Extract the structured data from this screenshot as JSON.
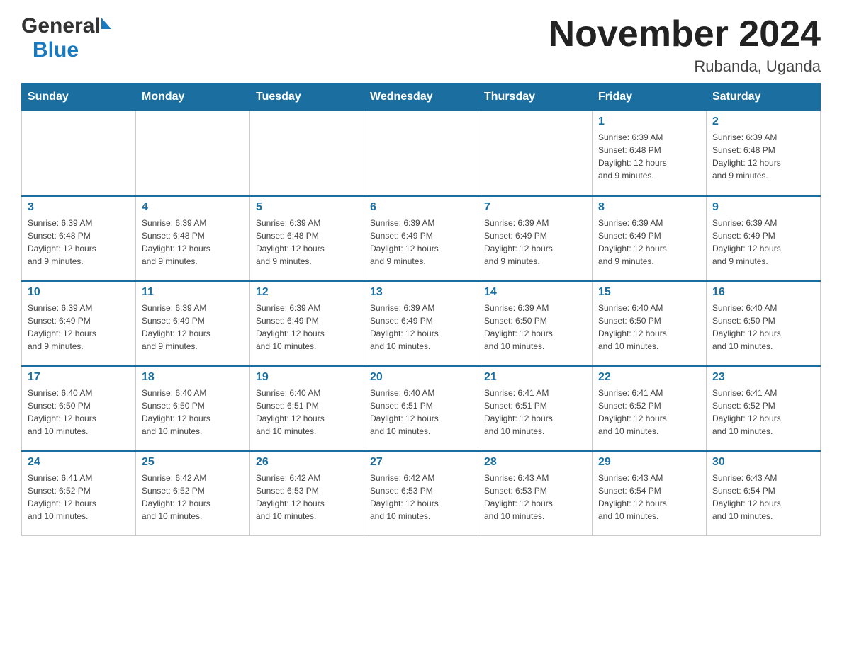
{
  "header": {
    "logo_general": "General",
    "logo_blue": "Blue",
    "month_title": "November 2024",
    "location": "Rubanda, Uganda"
  },
  "days_of_week": [
    "Sunday",
    "Monday",
    "Tuesday",
    "Wednesday",
    "Thursday",
    "Friday",
    "Saturday"
  ],
  "weeks": [
    [
      {
        "day": "",
        "info": ""
      },
      {
        "day": "",
        "info": ""
      },
      {
        "day": "",
        "info": ""
      },
      {
        "day": "",
        "info": ""
      },
      {
        "day": "",
        "info": ""
      },
      {
        "day": "1",
        "info": "Sunrise: 6:39 AM\nSunset: 6:48 PM\nDaylight: 12 hours\nand 9 minutes."
      },
      {
        "day": "2",
        "info": "Sunrise: 6:39 AM\nSunset: 6:48 PM\nDaylight: 12 hours\nand 9 minutes."
      }
    ],
    [
      {
        "day": "3",
        "info": "Sunrise: 6:39 AM\nSunset: 6:48 PM\nDaylight: 12 hours\nand 9 minutes."
      },
      {
        "day": "4",
        "info": "Sunrise: 6:39 AM\nSunset: 6:48 PM\nDaylight: 12 hours\nand 9 minutes."
      },
      {
        "day": "5",
        "info": "Sunrise: 6:39 AM\nSunset: 6:48 PM\nDaylight: 12 hours\nand 9 minutes."
      },
      {
        "day": "6",
        "info": "Sunrise: 6:39 AM\nSunset: 6:49 PM\nDaylight: 12 hours\nand 9 minutes."
      },
      {
        "day": "7",
        "info": "Sunrise: 6:39 AM\nSunset: 6:49 PM\nDaylight: 12 hours\nand 9 minutes."
      },
      {
        "day": "8",
        "info": "Sunrise: 6:39 AM\nSunset: 6:49 PM\nDaylight: 12 hours\nand 9 minutes."
      },
      {
        "day": "9",
        "info": "Sunrise: 6:39 AM\nSunset: 6:49 PM\nDaylight: 12 hours\nand 9 minutes."
      }
    ],
    [
      {
        "day": "10",
        "info": "Sunrise: 6:39 AM\nSunset: 6:49 PM\nDaylight: 12 hours\nand 9 minutes."
      },
      {
        "day": "11",
        "info": "Sunrise: 6:39 AM\nSunset: 6:49 PM\nDaylight: 12 hours\nand 9 minutes."
      },
      {
        "day": "12",
        "info": "Sunrise: 6:39 AM\nSunset: 6:49 PM\nDaylight: 12 hours\nand 10 minutes."
      },
      {
        "day": "13",
        "info": "Sunrise: 6:39 AM\nSunset: 6:49 PM\nDaylight: 12 hours\nand 10 minutes."
      },
      {
        "day": "14",
        "info": "Sunrise: 6:39 AM\nSunset: 6:50 PM\nDaylight: 12 hours\nand 10 minutes."
      },
      {
        "day": "15",
        "info": "Sunrise: 6:40 AM\nSunset: 6:50 PM\nDaylight: 12 hours\nand 10 minutes."
      },
      {
        "day": "16",
        "info": "Sunrise: 6:40 AM\nSunset: 6:50 PM\nDaylight: 12 hours\nand 10 minutes."
      }
    ],
    [
      {
        "day": "17",
        "info": "Sunrise: 6:40 AM\nSunset: 6:50 PM\nDaylight: 12 hours\nand 10 minutes."
      },
      {
        "day": "18",
        "info": "Sunrise: 6:40 AM\nSunset: 6:50 PM\nDaylight: 12 hours\nand 10 minutes."
      },
      {
        "day": "19",
        "info": "Sunrise: 6:40 AM\nSunset: 6:51 PM\nDaylight: 12 hours\nand 10 minutes."
      },
      {
        "day": "20",
        "info": "Sunrise: 6:40 AM\nSunset: 6:51 PM\nDaylight: 12 hours\nand 10 minutes."
      },
      {
        "day": "21",
        "info": "Sunrise: 6:41 AM\nSunset: 6:51 PM\nDaylight: 12 hours\nand 10 minutes."
      },
      {
        "day": "22",
        "info": "Sunrise: 6:41 AM\nSunset: 6:52 PM\nDaylight: 12 hours\nand 10 minutes."
      },
      {
        "day": "23",
        "info": "Sunrise: 6:41 AM\nSunset: 6:52 PM\nDaylight: 12 hours\nand 10 minutes."
      }
    ],
    [
      {
        "day": "24",
        "info": "Sunrise: 6:41 AM\nSunset: 6:52 PM\nDaylight: 12 hours\nand 10 minutes."
      },
      {
        "day": "25",
        "info": "Sunrise: 6:42 AM\nSunset: 6:52 PM\nDaylight: 12 hours\nand 10 minutes."
      },
      {
        "day": "26",
        "info": "Sunrise: 6:42 AM\nSunset: 6:53 PM\nDaylight: 12 hours\nand 10 minutes."
      },
      {
        "day": "27",
        "info": "Sunrise: 6:42 AM\nSunset: 6:53 PM\nDaylight: 12 hours\nand 10 minutes."
      },
      {
        "day": "28",
        "info": "Sunrise: 6:43 AM\nSunset: 6:53 PM\nDaylight: 12 hours\nand 10 minutes."
      },
      {
        "day": "29",
        "info": "Sunrise: 6:43 AM\nSunset: 6:54 PM\nDaylight: 12 hours\nand 10 minutes."
      },
      {
        "day": "30",
        "info": "Sunrise: 6:43 AM\nSunset: 6:54 PM\nDaylight: 12 hours\nand 10 minutes."
      }
    ]
  ]
}
